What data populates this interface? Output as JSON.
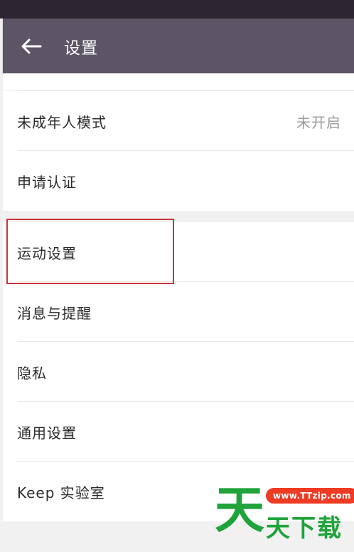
{
  "colors": {
    "status_bar": "#2b2630",
    "nav_bar": "#5d5566",
    "page_bg": "#f1f1f1",
    "highlight": "#c8353b",
    "watermark_green": "#1fa33a",
    "watermark_red": "#ee3b24"
  },
  "header": {
    "back_icon": "arrow-left-icon",
    "title": "设置"
  },
  "group1": {
    "items": [
      {
        "label": "未成年人模式",
        "value": "未开启"
      },
      {
        "label": "申请认证"
      }
    ]
  },
  "group2": {
    "items": [
      {
        "label": "运动设置"
      },
      {
        "label": "消息与提醒"
      },
      {
        "label": "隐私"
      },
      {
        "label": "通用设置"
      },
      {
        "label": "Keep 实验室"
      }
    ]
  },
  "watermark": {
    "big_char": "天",
    "text": "天下载",
    "url": "www.TTzip.com"
  }
}
